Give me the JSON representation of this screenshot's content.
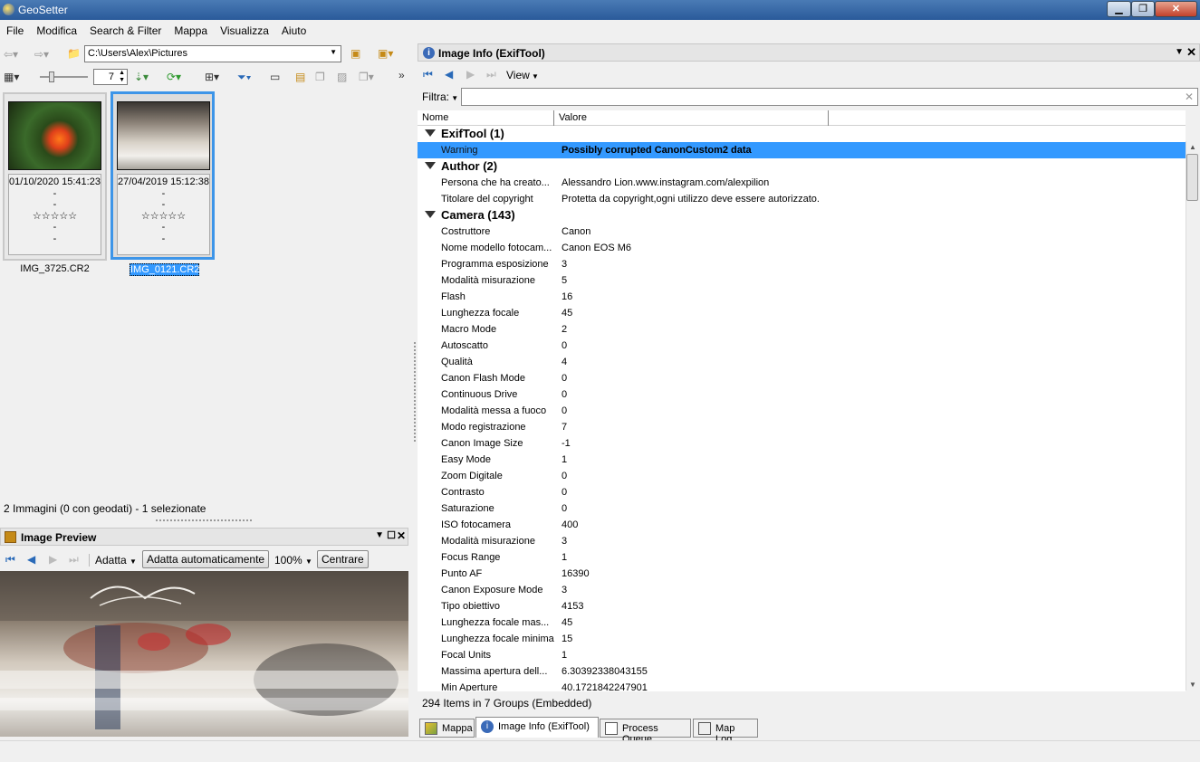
{
  "window": {
    "title": "GeoSetter"
  },
  "menu": [
    "File",
    "Modifica",
    "Search & Filter",
    "Mappa",
    "Visualizza",
    "Aiuto"
  ],
  "toolbar": {
    "path": "C:\\Users\\Alex\\Pictures",
    "zoom_value": "7"
  },
  "thumbnails": [
    {
      "date": "01/10/2020 15:41:23",
      "line2": "-",
      "line3": "-",
      "stars": "☆☆☆☆☆",
      "line5": "-",
      "line6": "-",
      "name": "IMG_3725.CR2"
    },
    {
      "date": "27/04/2019 15:12:38",
      "line2": "-",
      "line3": "-",
      "stars": "☆☆☆☆☆",
      "line5": "-",
      "line6": "-",
      "name": "IMG_0121.CR2"
    }
  ],
  "left_status": "2 Immagini (0 con geodati) - 1 selezionate",
  "preview": {
    "title": "Image Preview",
    "fit_label": "Adatta",
    "auto_fit_label": "Adatta automaticamente",
    "zoom": "100%",
    "center_label": "Centrare"
  },
  "info_panel": {
    "title": "Image Info (ExifTool)",
    "view_label": "View",
    "filter_label": "Filtra:",
    "col_name": "Nome",
    "col_value": "Valore",
    "groups": [
      {
        "label": "ExifTool (1)",
        "rows": [
          {
            "k": "Warning",
            "v": "Possibly corrupted CanonCustom2 data",
            "selected": true
          }
        ]
      },
      {
        "label": "Author (2)",
        "rows": [
          {
            "k": "Persona che ha creato...",
            "v": "Alessandro Lion.www.instagram.com/alexpilion"
          },
          {
            "k": "Titolare del copyright",
            "v": "Protetta da copyright,ogni utilizzo deve essere autorizzato."
          }
        ]
      },
      {
        "label": "Camera (143)",
        "rows": [
          {
            "k": "Costruttore",
            "v": "Canon"
          },
          {
            "k": "Nome modello fotocam...",
            "v": "Canon EOS M6"
          },
          {
            "k": "Programma esposizione",
            "v": "3"
          },
          {
            "k": "Modalità misurazione",
            "v": "5"
          },
          {
            "k": "Flash",
            "v": "16"
          },
          {
            "k": "Lunghezza focale",
            "v": "45"
          },
          {
            "k": "Macro Mode",
            "v": "2"
          },
          {
            "k": "Autoscatto",
            "v": "0"
          },
          {
            "k": "Qualità",
            "v": "4"
          },
          {
            "k": "Canon Flash Mode",
            "v": "0"
          },
          {
            "k": "Continuous Drive",
            "v": "0"
          },
          {
            "k": "Modalità messa a fuoco",
            "v": "0"
          },
          {
            "k": "Modo registrazione",
            "v": "7"
          },
          {
            "k": "Canon Image Size",
            "v": "-1"
          },
          {
            "k": "Easy Mode",
            "v": "1"
          },
          {
            "k": "Zoom Digitale",
            "v": "0"
          },
          {
            "k": "Contrasto",
            "v": "0"
          },
          {
            "k": "Saturazione",
            "v": "0"
          },
          {
            "k": "ISO fotocamera",
            "v": "400"
          },
          {
            "k": "Modalità misurazione",
            "v": "3"
          },
          {
            "k": "Focus Range",
            "v": "1"
          },
          {
            "k": "Punto AF",
            "v": "16390"
          },
          {
            "k": "Canon Exposure Mode",
            "v": "3"
          },
          {
            "k": "Tipo obiettivo",
            "v": "4153"
          },
          {
            "k": "Lunghezza focale mas...",
            "v": "45"
          },
          {
            "k": "Lunghezza focale minima",
            "v": "15"
          },
          {
            "k": "Focal Units",
            "v": "1"
          },
          {
            "k": "Massima apertura dell...",
            "v": "6.30392338043155"
          },
          {
            "k": "Min Aperture",
            "v": "40.1721842247901"
          }
        ]
      }
    ],
    "status": "294 Items in 7 Groups   (Embedded)"
  },
  "tabs": [
    "Mappa",
    "Image Info (ExifTool)",
    "Process Queue",
    "Map Log"
  ]
}
